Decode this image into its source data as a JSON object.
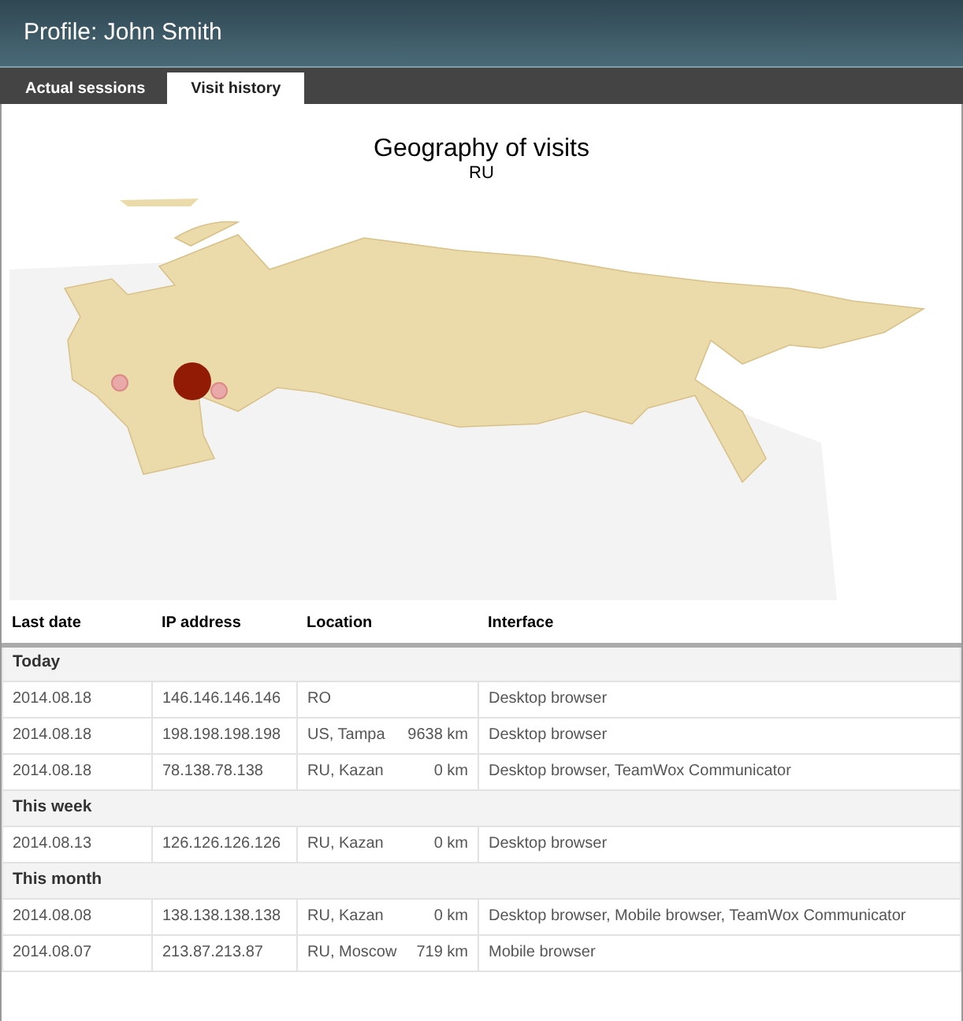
{
  "window": {
    "title": "Profile: John Smith"
  },
  "tabs": [
    {
      "label": "Actual sessions",
      "selected": false
    },
    {
      "label": "Visit history",
      "selected": true
    }
  ],
  "map": {
    "title": "Geography of visits",
    "subtitle": "RU"
  },
  "table": {
    "columns": [
      "Last date",
      "IP address",
      "Location",
      "Interface"
    ],
    "groups": [
      {
        "label": "Today",
        "rows": [
          {
            "date": "2014.08.18",
            "ip": "146.146.146.146",
            "location": "RO",
            "interface": "Desktop browser"
          },
          {
            "date": "2014.08.18",
            "ip": "198.198.198.198",
            "location": "US, Tampa",
            "distance": "9638 km",
            "interface": "Desktop browser"
          },
          {
            "date": "2014.08.18",
            "ip": "78.138.78.138",
            "location": "RU, Kazan",
            "distance": "0 km",
            "interface": "Desktop browser, TeamWox Communicator"
          }
        ]
      },
      {
        "label": "This week",
        "rows": [
          {
            "date": "2014.08.13",
            "ip": "126.126.126.126",
            "location": "RU, Kazan",
            "distance": "0 km",
            "interface": "Desktop browser"
          }
        ]
      },
      {
        "label": "This month",
        "rows": [
          {
            "date": "2014.08.08",
            "ip": "138.138.138.138",
            "location": "RU, Kazan",
            "distance": "0 km",
            "interface": "Desktop browser, Mobile browser, TeamWox Communicator"
          },
          {
            "date": "2014.08.07",
            "ip": "213.87.213.87",
            "location": "RU, Moscow",
            "distance": "719 km",
            "interface": "Mobile browser"
          }
        ]
      }
    ]
  }
}
